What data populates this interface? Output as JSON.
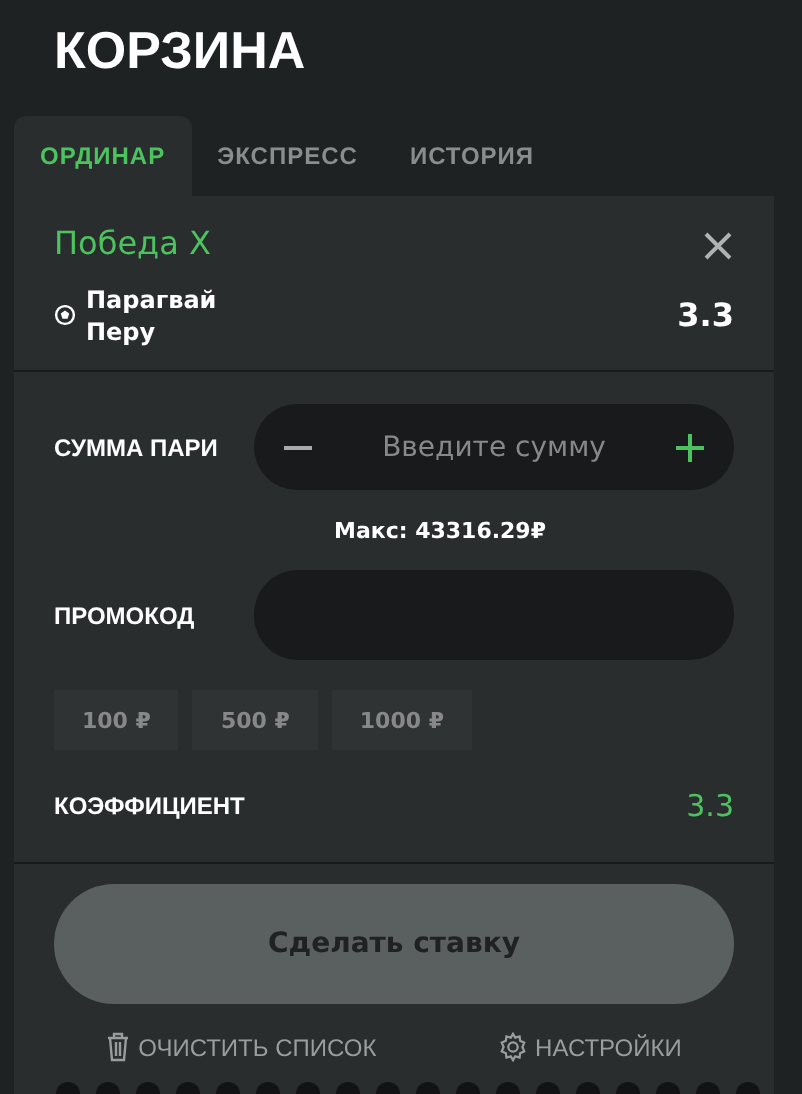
{
  "title": "КОРЗИНА",
  "tabs": [
    {
      "label": "ОРДИНАР",
      "selected": true
    },
    {
      "label": "ЭКСПРЕСС",
      "selected": false
    },
    {
      "label": "ИСТОРИЯ",
      "selected": false
    }
  ],
  "bet": {
    "outcome": "Победа X",
    "teams": [
      "Парагвай",
      "Перу"
    ],
    "odds": "3.3"
  },
  "stake": {
    "label": "СУММА ПАРИ",
    "placeholder": "Введите сумму",
    "max": "Макс: 43316.29₽"
  },
  "promo": {
    "label": "ПРОМОКОД"
  },
  "quick_amounts": [
    "100 ₽",
    "500 ₽",
    "1000 ₽"
  ],
  "coefficient": {
    "label": "КОЭФФИЦИЕНТ",
    "value": "3.3"
  },
  "submit": {
    "label": "Сделать ставку",
    "disabled": true
  },
  "footer": [
    {
      "kind": "trash",
      "label": "ОЧИСТИТЬ СПИСОК"
    },
    {
      "kind": "gear",
      "label": "НАСТРОЙКИ"
    }
  ]
}
